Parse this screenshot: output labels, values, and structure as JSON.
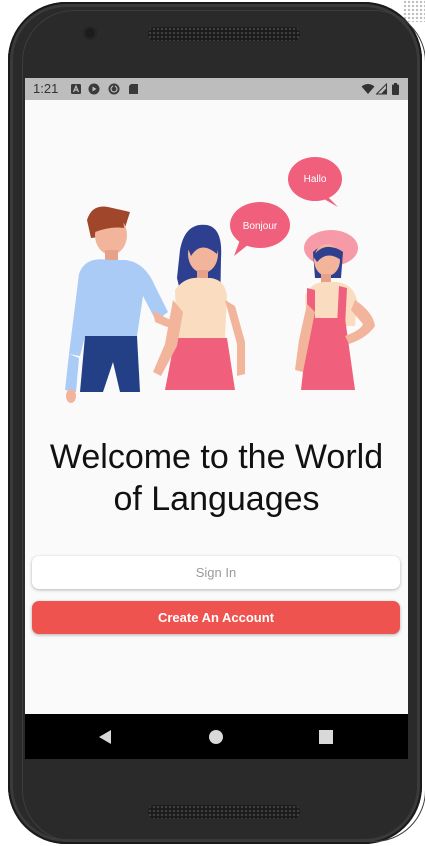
{
  "status_bar": {
    "time": "1:21",
    "left_icons": [
      "a-badge-icon",
      "play-store-icon",
      "sync-icon",
      "sd-card-icon"
    ],
    "right_icons": [
      "wifi-icon",
      "cell-signal-icon",
      "battery-icon"
    ]
  },
  "illustration": {
    "bubble_right": "Hallo",
    "bubble_left": "Bonjour"
  },
  "welcome": {
    "line1": "Welcome to the World",
    "line2": "of Languages"
  },
  "buttons": {
    "sign_in": "Sign In",
    "create_account": "Create An Account"
  },
  "nav": {
    "icons": [
      "back-triangle-icon",
      "home-circle-icon",
      "recents-square-icon"
    ]
  },
  "colors": {
    "accent": "#ef5350",
    "bubble": "#f05f7b",
    "screen_bg": "#fafafa",
    "status_bar": "#bdbdbd"
  }
}
